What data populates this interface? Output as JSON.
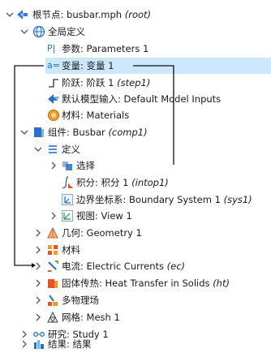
{
  "tree": {
    "root": {
      "label": "根节点: busbar.mph",
      "tag": "(root)"
    },
    "global_defs": {
      "label": "全局定义"
    },
    "parameters": {
      "label": "参数: Parameters 1"
    },
    "variables": {
      "label": "变量: 变量 1"
    },
    "step": {
      "label": "阶跃: 阶跃 1",
      "tag": "(step1)"
    },
    "default_inputs": {
      "label": "默认模型输入: Default Model Inputs"
    },
    "materials_global": {
      "label": "材料: Materials"
    },
    "component": {
      "label": "组件: Busbar",
      "tag": "(comp1)"
    },
    "definitions": {
      "label": "定义"
    },
    "selection": {
      "label": "选择"
    },
    "integration": {
      "label": "积分: 积分 1",
      "tag": "(intop1)"
    },
    "boundary_system": {
      "label": "边界坐标系: Boundary System 1",
      "tag": "(sys1)"
    },
    "view": {
      "label": "视图: View 1"
    },
    "geometry": {
      "label": "几何: Geometry 1"
    },
    "materials_comp": {
      "label": "材料"
    },
    "electric_currents": {
      "label": "电流: Electric Currents",
      "tag": "(ec)"
    },
    "heat_transfer": {
      "label": "固体传热: Heat Transfer in Solids",
      "tag": "(ht)"
    },
    "multiphysics": {
      "label": "多物理场"
    },
    "mesh": {
      "label": "网格: Mesh 1"
    },
    "study": {
      "label": "研究: Study 1"
    },
    "results": {
      "label": "结果: 结果"
    }
  },
  "colors": {
    "selection": "#cce8ff",
    "connector": "#111111",
    "chevron": "#555555"
  }
}
